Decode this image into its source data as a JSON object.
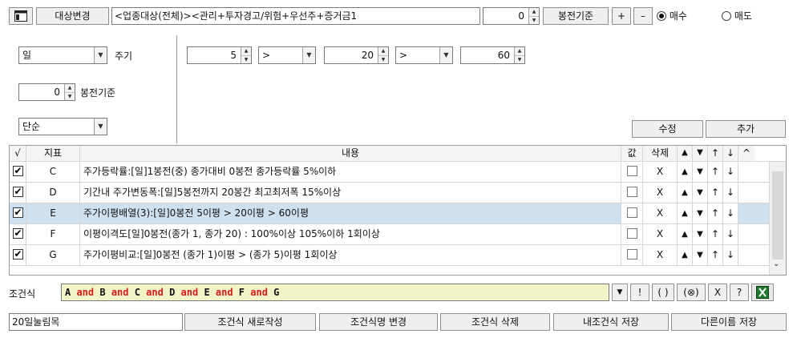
{
  "toolbar": {
    "target_change_label": "대상변경",
    "filter_text": "<업종대상(전체)><관리+투자경고/위험+우선주+증거금1",
    "bong_value": "0",
    "bong_label": "봉전기준",
    "plus_label": "+",
    "minus_label": "–",
    "buy_label": "매수",
    "sell_label": "매도",
    "selected_mode": "buy"
  },
  "settings": {
    "period_value": "일",
    "period_label": "주기",
    "bong_value": "0",
    "bong_label": "봉전기준",
    "mode_value": "단순",
    "ma1": "5",
    "op1": ">",
    "ma2": "20",
    "op2": ">",
    "ma3": "60",
    "edit_label": "수정",
    "add_label": "추가"
  },
  "table": {
    "headers": {
      "check": "√",
      "index": "지표",
      "content": "내용",
      "value": "값",
      "delete": "삭제",
      "up": "▲",
      "down": "▼",
      "top": "↑",
      "bottom": "↓",
      "scroll": "^"
    },
    "rows": [
      {
        "checked": true,
        "index": "C",
        "content": "주가등락률:[일]1봉전(중) 종가대비 0봉전 종가등락률 5%이하",
        "delete": "X",
        "up": "▲",
        "down": "▼",
        "top": "↑",
        "bottom": "↓"
      },
      {
        "checked": true,
        "index": "D",
        "content": "기간내 주가변동폭:[일]5봉전까지 20봉간 최고최저폭 15%이상",
        "delete": "X",
        "up": "▲",
        "down": "▼",
        "top": "↑",
        "bottom": "↓"
      },
      {
        "checked": true,
        "index": "E",
        "content": "주가이평배열(3):[일]0봉전 5이평 > 20이평 > 60이평",
        "delete": "X",
        "up": "▲",
        "down": "▼",
        "top": "↑",
        "bottom": "↓",
        "selected": true
      },
      {
        "checked": true,
        "index": "F",
        "content": "이평이격도[일]0봉전(종가 1, 종가 20) : 100%이상 105%이하 1회이상",
        "delete": "X",
        "up": "▲",
        "down": "▼",
        "top": "↑",
        "bottom": "↓"
      },
      {
        "checked": true,
        "index": "G",
        "content": "주가이평비교:[일]0봉전 (종가 1)이평 > (종가 5)이평 1회이상",
        "delete": "X",
        "up": "▲",
        "down": "▼",
        "top": "↑",
        "bottom": "↓"
      }
    ]
  },
  "condition": {
    "label": "조건식",
    "tokens": [
      {
        "t": "A",
        "kw": false
      },
      {
        "t": "and",
        "kw": true
      },
      {
        "t": "B",
        "kw": false
      },
      {
        "t": "and",
        "kw": true
      },
      {
        "t": "C",
        "kw": false
      },
      {
        "t": "and",
        "kw": true
      },
      {
        "t": "D",
        "kw": false
      },
      {
        "t": "and",
        "kw": true
      },
      {
        "t": "E",
        "kw": false
      },
      {
        "t": "and",
        "kw": true
      },
      {
        "t": "F",
        "kw": false
      },
      {
        "t": "and",
        "kw": true
      },
      {
        "t": "G",
        "kw": false
      }
    ],
    "dropdown": "▼",
    "not_label": "!",
    "paren_label": "( )",
    "xor_label": "(⊗)",
    "x_label": "X",
    "help_label": "?"
  },
  "bottom": {
    "name_value": "20일눌림목",
    "new_label": "조건식 새로작성",
    "rename_label": "조건식명 변경",
    "delete_label": "조건식 삭제",
    "save_label": "내조건식 저장",
    "saveas_label": "다른이름 저장"
  },
  "colors": {
    "accent_selected_row": "#cfe0ee",
    "keyword": "#d91a1a",
    "condition_bg": "#f3f3c8",
    "excel_icon": "#1e7a2e"
  }
}
